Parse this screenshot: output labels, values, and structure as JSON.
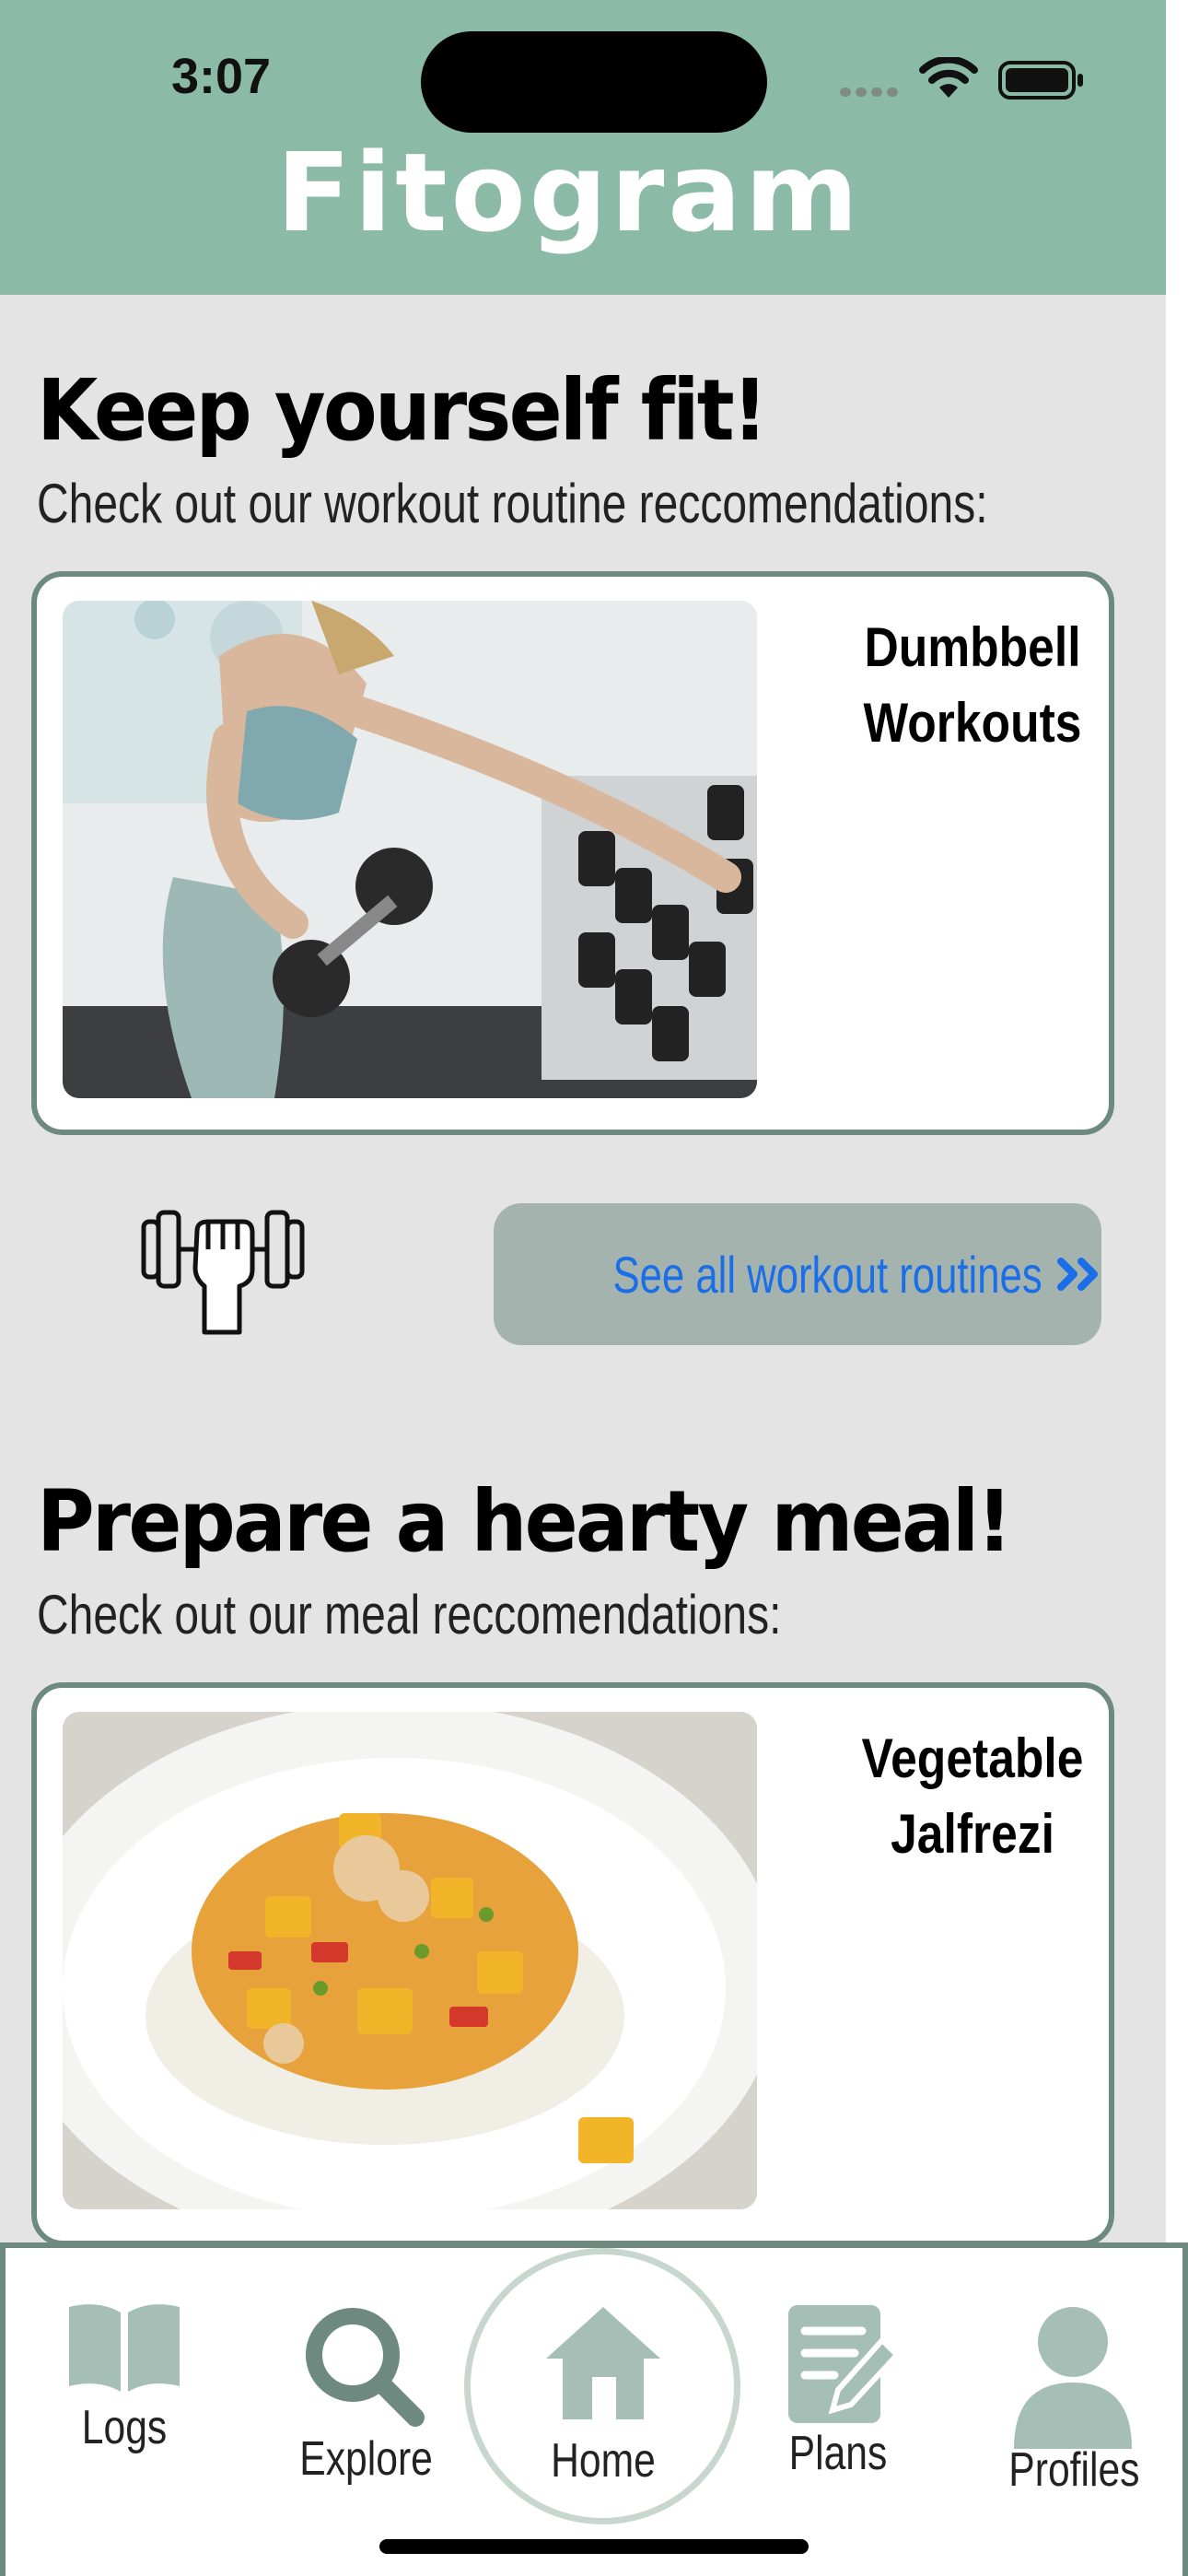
{
  "status_bar": {
    "time": "3:07"
  },
  "header": {
    "title": "Fitogram"
  },
  "workout_section": {
    "heading": "Keep yourself fit!",
    "subheading": "Check out our workout routine reccomendations:",
    "card_title_line1": "Dumbbell",
    "card_title_line2": "Workouts",
    "see_all_label": "See all workout routines",
    "see_all_icon": "double-chevron-right-icon"
  },
  "meal_section": {
    "heading": "Prepare a hearty meal!",
    "subheading": "Check out our meal reccomendations:",
    "card_title_line1": "Vegetable",
    "card_title_line2": "Jalfrezi"
  },
  "bottom_nav": {
    "logs": "Logs",
    "explore": "Explore",
    "home": "Home",
    "plans": "Plans",
    "profiles": "Profiles"
  },
  "colors": {
    "header_bg": "#8bbba7",
    "page_bg": "#e4e4e4",
    "card_border": "#6e8a80",
    "button_bg": "#a5b3ae",
    "button_text": "#1a6ee8",
    "nav_icon": "#a5bfb7"
  }
}
